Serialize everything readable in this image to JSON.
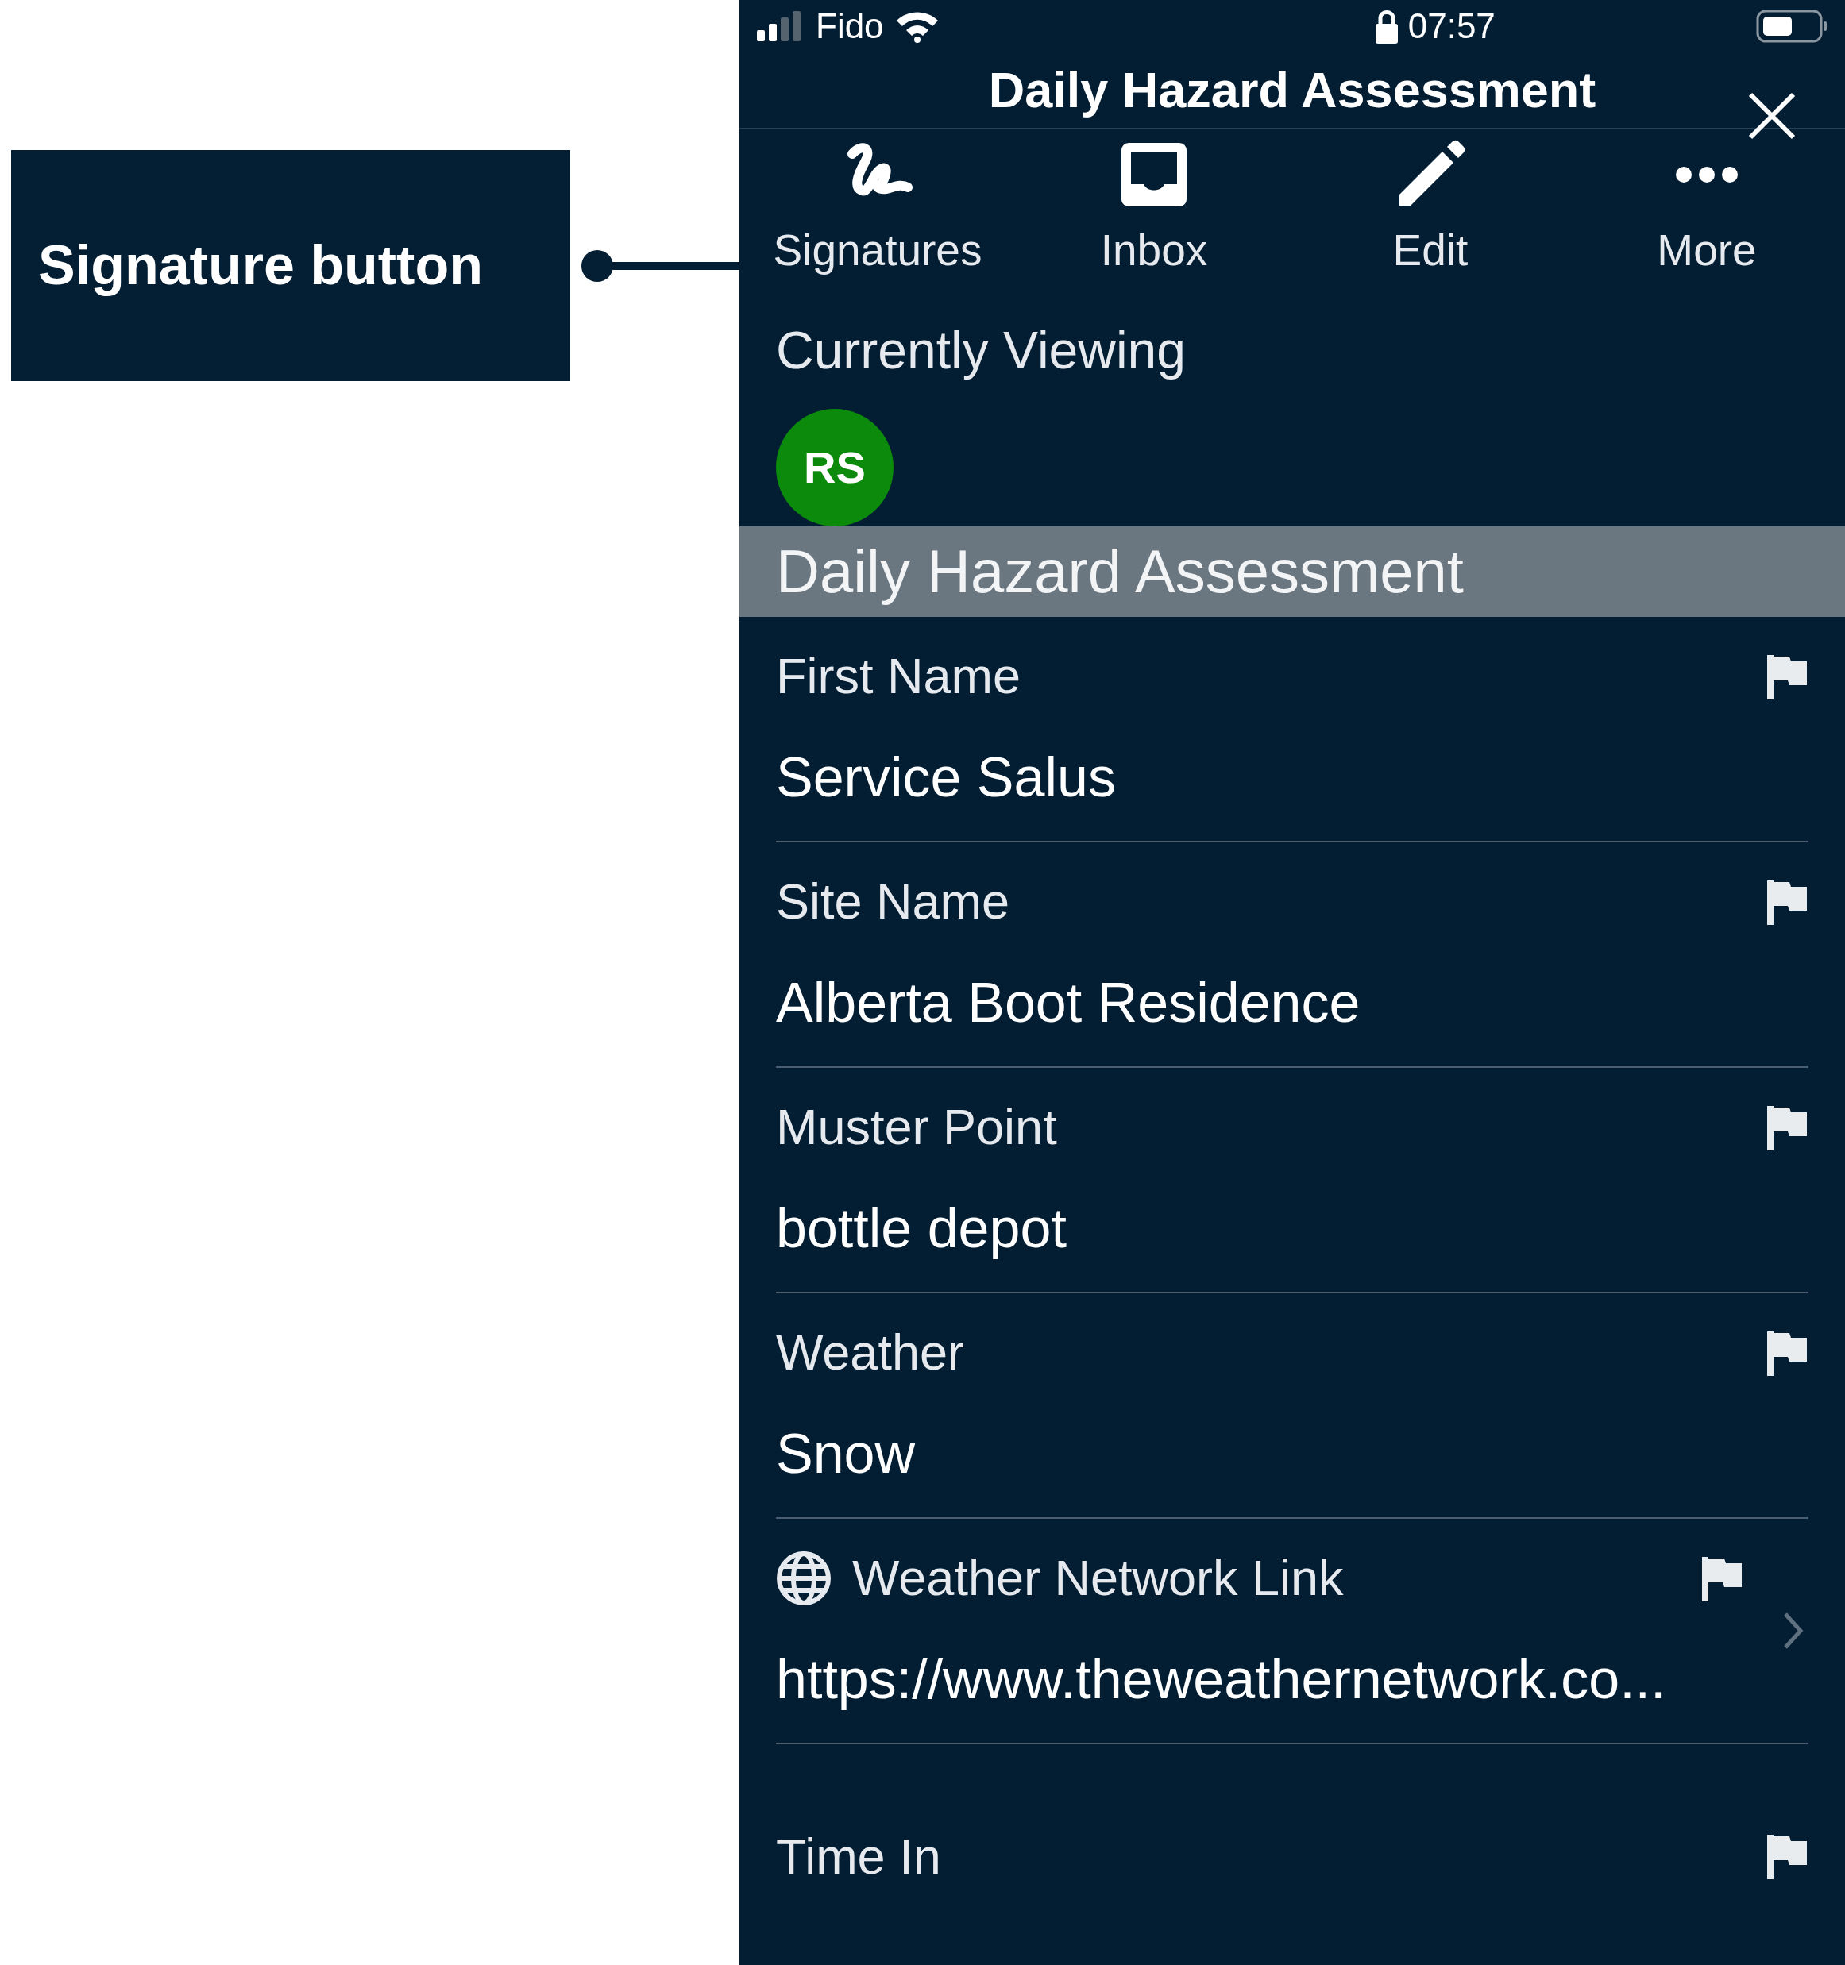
{
  "annotation": {
    "label": "Signature button"
  },
  "status_bar": {
    "carrier": "Fido",
    "time": "07:57"
  },
  "header": {
    "title": "Daily Hazard Assessment"
  },
  "toolbar": [
    {
      "label": "Signatures",
      "kind": "signature"
    },
    {
      "label": "Inbox",
      "kind": "inbox"
    },
    {
      "label": "Edit",
      "kind": "edit"
    },
    {
      "label": "More",
      "kind": "more"
    }
  ],
  "viewers": {
    "heading": "Currently Viewing",
    "users": [
      {
        "initials": "RS"
      }
    ]
  },
  "section": {
    "title": "Daily Hazard Assessment"
  },
  "fields": [
    {
      "kind": "text",
      "label": "First Name",
      "value": "Service Salus"
    },
    {
      "kind": "text",
      "label": "Site Name",
      "value": "Alberta Boot Residence"
    },
    {
      "kind": "text",
      "label": "Muster Point",
      "value": "bottle depot"
    },
    {
      "kind": "text",
      "label": "Weather",
      "value": "Snow"
    },
    {
      "kind": "link",
      "label": "Weather Network Link",
      "value": "https://www.theweathernetwork.co..."
    },
    {
      "kind": "text",
      "label": "Time In"
    }
  ]
}
